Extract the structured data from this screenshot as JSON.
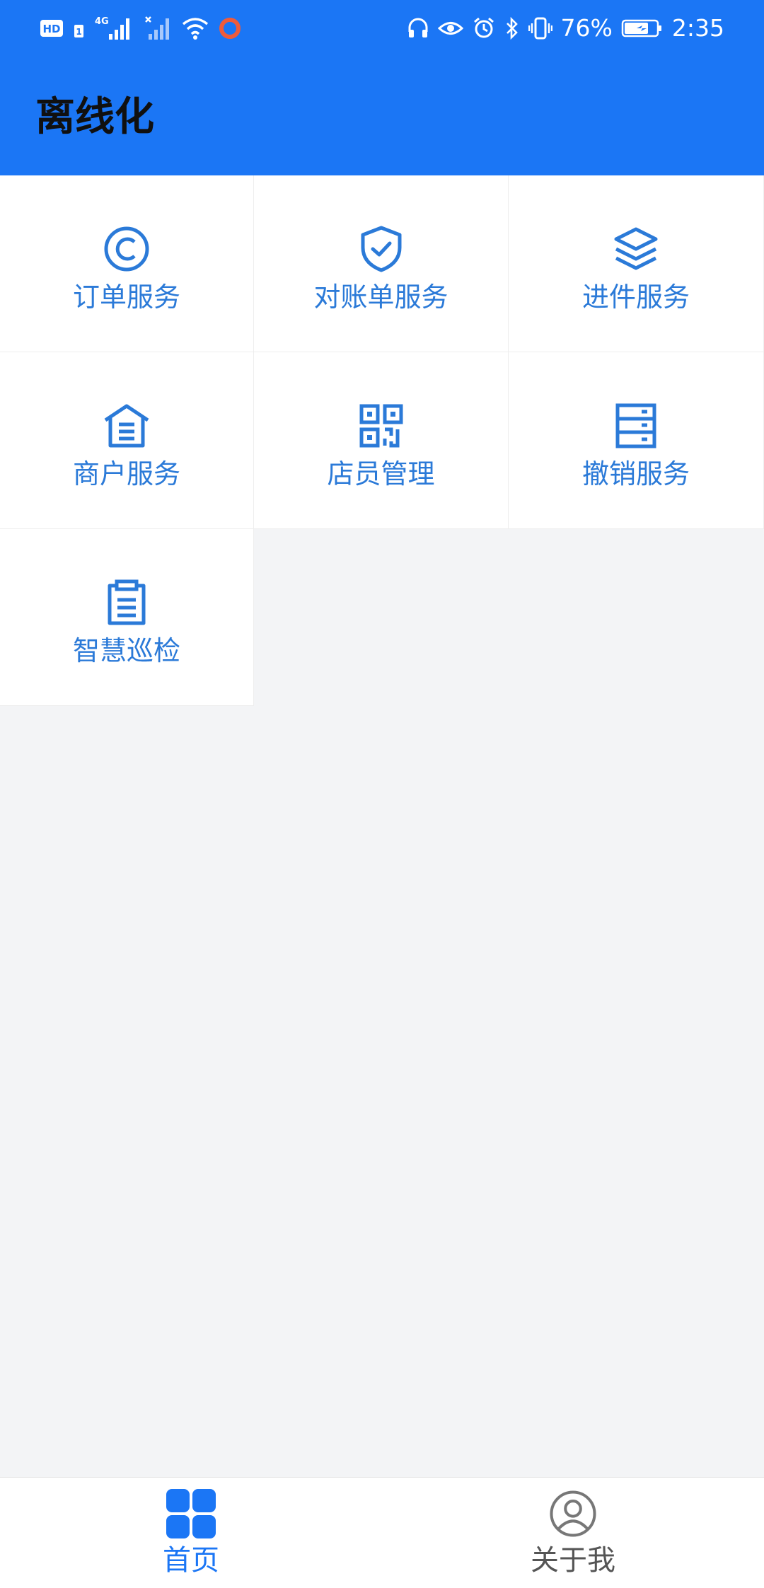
{
  "status_bar": {
    "left_icons": [
      "hd-icon",
      "sim1-icon",
      "signal-4g-icon",
      "signal-nosim-icon",
      "wifi-icon",
      "ring-app-icon"
    ],
    "network_label": "4G",
    "right_icons": [
      "headset-icon",
      "eye-icon",
      "alarm-icon",
      "bluetooth-icon",
      "vibrate-icon"
    ],
    "battery_percent": "76%",
    "battery_level": 0.76,
    "time": "2:35"
  },
  "app_bar": {
    "title": "离线化"
  },
  "grid": {
    "items": [
      {
        "label": "订单服务",
        "icon": "copyright-icon"
      },
      {
        "label": "对账单服务",
        "icon": "shield-check-icon"
      },
      {
        "label": "进件服务",
        "icon": "layers-icon"
      },
      {
        "label": "商户服务",
        "icon": "store-house-icon"
      },
      {
        "label": "店员管理",
        "icon": "qrcode-icon"
      },
      {
        "label": "撤销服务",
        "icon": "server-icon"
      },
      {
        "label": "智慧巡检",
        "icon": "clipboard-icon"
      }
    ]
  },
  "bottom_nav": {
    "items": [
      {
        "label": "首页",
        "icon": "grid-home-icon",
        "active": true
      },
      {
        "label": "关于我",
        "icon": "user-circle-icon",
        "active": false
      }
    ]
  },
  "colors": {
    "primary": "#1b76f5",
    "grid_label": "#2b7ad8",
    "background": "#f3f4f6",
    "nav_inactive": "#555555"
  }
}
